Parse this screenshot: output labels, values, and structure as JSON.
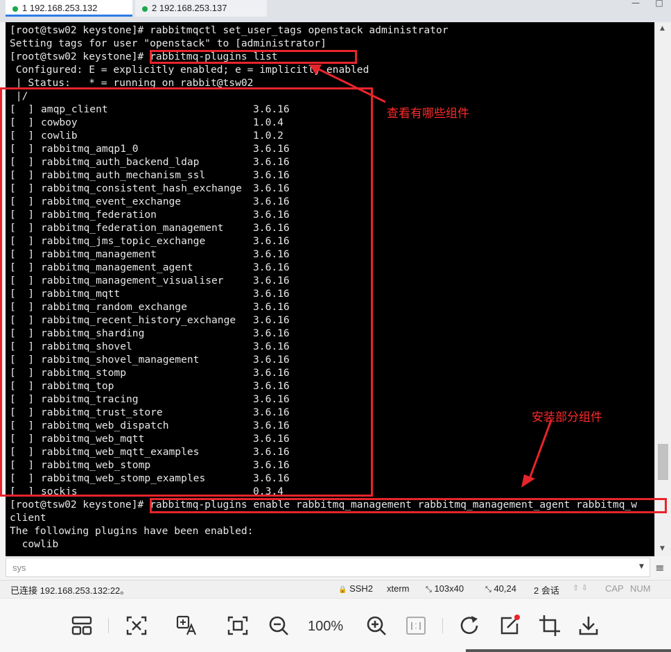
{
  "tabs": [
    {
      "label": "1 192.168.253.132"
    },
    {
      "label": "2 192.168.253.137"
    }
  ],
  "window_controls": {
    "minimize": "—",
    "maximize": "□"
  },
  "terminal": {
    "lines_before": [
      "[root@tsw02 keystone]# rabbitmqctl set_user_tags openstack administrator",
      "Setting tags for user \"openstack\" to [administrator]",
      "[root@tsw02 keystone]# rabbitmq-plugins list",
      " Configured: E = explicitly enabled; e = implicitly enabled",
      " | Status:   * = running on rabbit@tsw02",
      " |/"
    ],
    "plugins": [
      {
        "mark": "[  ]",
        "name": "amqp_client",
        "version": "3.6.16"
      },
      {
        "mark": "[  ]",
        "name": "cowboy",
        "version": "1.0.4"
      },
      {
        "mark": "[  ]",
        "name": "cowlib",
        "version": "1.0.2"
      },
      {
        "mark": "[  ]",
        "name": "rabbitmq_amqp1_0",
        "version": "3.6.16"
      },
      {
        "mark": "[  ]",
        "name": "rabbitmq_auth_backend_ldap",
        "version": "3.6.16"
      },
      {
        "mark": "[  ]",
        "name": "rabbitmq_auth_mechanism_ssl",
        "version": "3.6.16"
      },
      {
        "mark": "[  ]",
        "name": "rabbitmq_consistent_hash_exchange",
        "version": "3.6.16"
      },
      {
        "mark": "[  ]",
        "name": "rabbitmq_event_exchange",
        "version": "3.6.16"
      },
      {
        "mark": "[  ]",
        "name": "rabbitmq_federation",
        "version": "3.6.16"
      },
      {
        "mark": "[  ]",
        "name": "rabbitmq_federation_management",
        "version": "3.6.16"
      },
      {
        "mark": "[  ]",
        "name": "rabbitmq_jms_topic_exchange",
        "version": "3.6.16"
      },
      {
        "mark": "[  ]",
        "name": "rabbitmq_management",
        "version": "3.6.16"
      },
      {
        "mark": "[  ]",
        "name": "rabbitmq_management_agent",
        "version": "3.6.16"
      },
      {
        "mark": "[  ]",
        "name": "rabbitmq_management_visualiser",
        "version": "3.6.16"
      },
      {
        "mark": "[  ]",
        "name": "rabbitmq_mqtt",
        "version": "3.6.16"
      },
      {
        "mark": "[  ]",
        "name": "rabbitmq_random_exchange",
        "version": "3.6.16"
      },
      {
        "mark": "[  ]",
        "name": "rabbitmq_recent_history_exchange",
        "version": "3.6.16"
      },
      {
        "mark": "[  ]",
        "name": "rabbitmq_sharding",
        "version": "3.6.16"
      },
      {
        "mark": "[  ]",
        "name": "rabbitmq_shovel",
        "version": "3.6.16"
      },
      {
        "mark": "[  ]",
        "name": "rabbitmq_shovel_management",
        "version": "3.6.16"
      },
      {
        "mark": "[  ]",
        "name": "rabbitmq_stomp",
        "version": "3.6.16"
      },
      {
        "mark": "[  ]",
        "name": "rabbitmq_top",
        "version": "3.6.16"
      },
      {
        "mark": "[  ]",
        "name": "rabbitmq_tracing",
        "version": "3.6.16"
      },
      {
        "mark": "[  ]",
        "name": "rabbitmq_trust_store",
        "version": "3.6.16"
      },
      {
        "mark": "[  ]",
        "name": "rabbitmq_web_dispatch",
        "version": "3.6.16"
      },
      {
        "mark": "[  ]",
        "name": "rabbitmq_web_mqtt",
        "version": "3.6.16"
      },
      {
        "mark": "[  ]",
        "name": "rabbitmq_web_mqtt_examples",
        "version": "3.6.16"
      },
      {
        "mark": "[  ]",
        "name": "rabbitmq_web_stomp",
        "version": "3.6.16"
      },
      {
        "mark": "[  ]",
        "name": "rabbitmq_web_stomp_examples",
        "version": "3.6.16"
      },
      {
        "mark": "[  ]",
        "name": "sockjs",
        "version": "0.3.4"
      }
    ],
    "lines_after": [
      "[root@tsw02 keystone]# rabbitmq-plugins enable rabbitmq_management rabbitmq_management_agent rabbitmq_w",
      "client",
      "The following plugins have been enabled:",
      "  cowlib"
    ]
  },
  "annotations": {
    "view_components": "查看有哪些组件",
    "install_components": "安装部分组件"
  },
  "session_bar": {
    "text": "sys",
    "menu_icon": "≡"
  },
  "status_bar": {
    "connection": "已连接 192.168.253.132:22。",
    "protocol": "SSH2",
    "term": "xterm",
    "size": "103x40",
    "cursor": "40,24",
    "sessions": "2 会话",
    "cap": "CAP",
    "num": "NUM"
  },
  "viewer": {
    "zoom": "100%"
  },
  "colors": {
    "accent_red": "#e8242b",
    "terminal_bg": "#000000",
    "terminal_fg": "#e8e8e8",
    "tab_accent": "#2c7be5"
  }
}
